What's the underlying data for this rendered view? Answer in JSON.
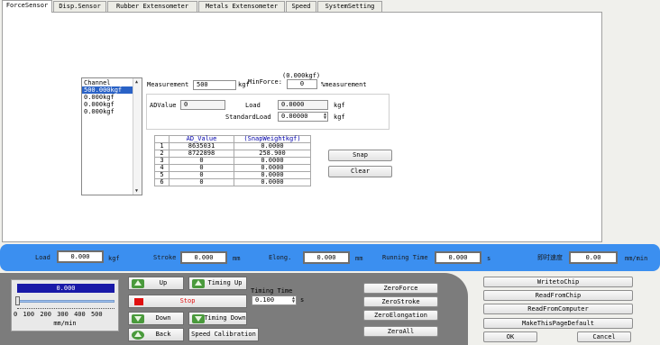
{
  "tabs": [
    "ForceSensor",
    "Disp.Sensor",
    "Rubber Extensometer",
    "Metals Extensometer",
    "Speed",
    "SystemSetting"
  ],
  "channel": {
    "label": "Channel",
    "items": [
      "500.000kgf",
      "0.000kgf",
      "0.000kgf",
      "0.000kgf"
    ]
  },
  "measurement": {
    "label": "Measurement",
    "value": "500",
    "unit": "kgf"
  },
  "min_force": {
    "caption": "(0.000kgf)",
    "label": "MinForce:",
    "value": "0",
    "unit": "%measurement"
  },
  "adcal": {
    "ad_label": "ADValue",
    "ad_value": "0",
    "load_label": "Load",
    "load_value": "0.0000",
    "load_unit": "kgf",
    "std_label": "StandardLoad",
    "std_value": "0.00000",
    "std_unit": "kgf"
  },
  "table": {
    "headers": [
      "",
      "AD_Value",
      "(SnapWeightkgf)"
    ],
    "rows": [
      [
        "1",
        "8635031",
        "0.0000"
      ],
      [
        "2",
        "8722898",
        "258.900"
      ],
      [
        "3",
        "0",
        "0.0000"
      ],
      [
        "4",
        "0",
        "0.0000"
      ],
      [
        "5",
        "0",
        "0.0000"
      ],
      [
        "6",
        "0",
        "0.0000"
      ]
    ]
  },
  "snap_label": "Snap",
  "clear_label": "Clear",
  "status": {
    "load_label": "Load",
    "load_value": "0.000",
    "load_unit": "kgf",
    "stroke_label": "Stroke",
    "stroke_value": "0.000",
    "stroke_unit": "mm",
    "elong_label": "Elong.",
    "elong_value": "0.000",
    "elong_unit": "mm",
    "time_label": "Running Time",
    "time_value": "0.000",
    "time_unit": "s",
    "speed_label": "即时速度",
    "speed_value": "0.00",
    "speed_unit": "mm/min"
  },
  "speed": {
    "display": "0.000",
    "level": 0.0,
    "ticks": [
      "0",
      "100",
      "200",
      "300",
      "400",
      "500"
    ],
    "unit": "mm/min"
  },
  "controls": {
    "up": "Up",
    "timing_up": "Timing Up",
    "stop": "Stop",
    "down": "Down",
    "timing_down": "Timing Down",
    "back": "Back",
    "speed_cal": "Speed Calibration",
    "timing_time_label": "Timing Time",
    "timing_time_value": "0.100",
    "timing_time_unit": "s"
  },
  "zero": {
    "force": "ZeroForce",
    "stroke": "ZeroStroke",
    "elongation": "ZeroElongation",
    "all": "ZeroAll"
  },
  "chip": {
    "write": "WritetoChip",
    "read_chip": "ReadFromChip",
    "read_computer": "ReadFromComputer",
    "default": "MakeThisPageDefault",
    "ok": "OK",
    "cancel": "Cancel"
  },
  "colors": {
    "status_bar": "#3b8ff0",
    "stop_red": "#e01010",
    "speed_display": "#1a1aa8",
    "selected": "#2a62c6"
  }
}
